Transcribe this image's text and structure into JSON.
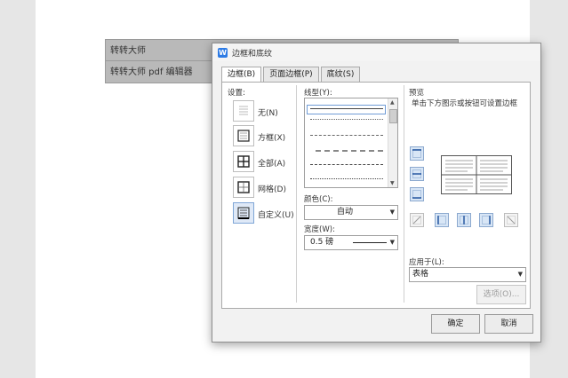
{
  "document": {
    "rows": [
      {
        "c1": "转转大师",
        "c2": ""
      },
      {
        "c1": "转转大师 pdf 编辑器",
        "c2": ""
      }
    ]
  },
  "dialog": {
    "app_icon": "W",
    "title": "边框和底纹",
    "tabs": [
      {
        "label": "边框(B)",
        "active": true
      },
      {
        "label": "页面边框(P)",
        "active": false
      },
      {
        "label": "底纹(S)",
        "active": false
      }
    ],
    "settings": {
      "label": "设置:",
      "items": [
        {
          "label": "无(N)"
        },
        {
          "label": "方框(X)"
        },
        {
          "label": "全部(A)"
        },
        {
          "label": "网格(D)"
        },
        {
          "label": "自定义(U)",
          "selected": true
        }
      ]
    },
    "line_style": {
      "label": "线型(Y):"
    },
    "color": {
      "label": "颜色(C):",
      "value": "自动"
    },
    "width": {
      "label": "宽度(W):",
      "value": "0.5  磅"
    },
    "preview": {
      "label": "预览",
      "hint": "单击下方图示或按钮可设置边框"
    },
    "apply_to": {
      "label": "应用于(L):",
      "value": "表格"
    },
    "options_label": "选项(O)...",
    "ok_label": "确定",
    "cancel_label": "取消"
  },
  "icons": {
    "app": "wps-writer-icon",
    "dropdown": "chevron-down-icon"
  },
  "colors": {
    "accent": "#2d7be5",
    "selected_bg": "#dfe9f7"
  }
}
